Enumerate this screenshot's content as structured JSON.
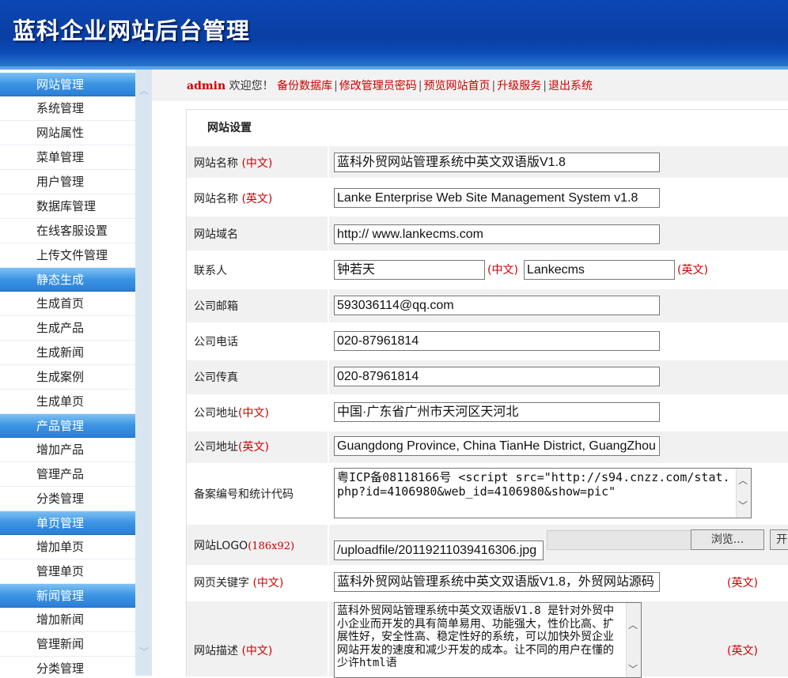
{
  "header": {
    "title": "蓝科企业网站后台管理"
  },
  "sidebar": {
    "groups": [
      {
        "title": "网站管理",
        "items": [
          "系统管理",
          "网站属性",
          "菜单管理",
          "用户管理",
          "数据库管理",
          "在线客服设置",
          "上传文件管理"
        ]
      },
      {
        "title": "静态生成",
        "items": [
          "生成首页",
          "生成产品",
          "生成新闻",
          "生成案例",
          "生成单页"
        ]
      },
      {
        "title": "产品管理",
        "items": [
          "增加产品",
          "管理产品",
          "分类管理"
        ]
      },
      {
        "title": "单页管理",
        "items": [
          "增加单页",
          "管理单页"
        ]
      },
      {
        "title": "新闻管理",
        "items": [
          "增加新闻",
          "管理新闻",
          "分类管理"
        ]
      }
    ]
  },
  "topbar": {
    "user": "admin",
    "welcome": "欢迎您！",
    "links": [
      "备份数据库",
      "修改管理员密码",
      "预览网站首页",
      "升级服务",
      "退出系统"
    ],
    "separator": "|"
  },
  "form": {
    "title": "网站设置",
    "cn_tag": "(中文)",
    "en_tag": "(英文)",
    "site_name": {
      "label": "网站名称",
      "cn_value": "蓝科外贸网站管理系统中英文双语版V1.8",
      "en_value": "Lanke Enterprise Web Site Management System v1.8"
    },
    "domain": {
      "label": "网站域名",
      "value": "http:// www.lankecms.com"
    },
    "contact": {
      "label": "联系人",
      "cn_value": "钟若天",
      "en_value": "Lankecms"
    },
    "email": {
      "label": "公司邮箱",
      "value": "593036114@qq.com"
    },
    "phone": {
      "label": "公司电话",
      "value": "020-87961814"
    },
    "fax": {
      "label": "公司传真",
      "value": "020-87961814"
    },
    "address": {
      "label": "公司地址",
      "cn_value": "中国·广东省广州市天河区天河北",
      "en_value": "Guangdong Province, China TianHe District, GuangZhou"
    },
    "icp": {
      "label": "备案编号和统计代码",
      "value": "粤ICP备08118166号 <script src=\"http://s94.cnzz.com/stat.php?id=4106980&web_id=4106980&show=pic\""
    },
    "logo": {
      "label": "网站LOGO",
      "size": "(186x92)",
      "value": "/uploadfile/20119211039416306.jpg",
      "browse": "浏览...",
      "upload": "开"
    },
    "keywords": {
      "label": "网页关键字",
      "value": "蓝科外贸网站管理系统中英文双语版V1.8，外贸网站源码"
    },
    "description": {
      "label": "网站描述",
      "value": "蓝科外贸网站管理系统中英文双语版V1.8 是针对外贸中小企业而开发的具有简单易用、功能强大，性价比高、扩展性好，安全性高、稳定性好的系统，可以加快外贸企业网站开发的速度和减少开发的成本。让不同的用户在懂的少许html语"
    }
  }
}
